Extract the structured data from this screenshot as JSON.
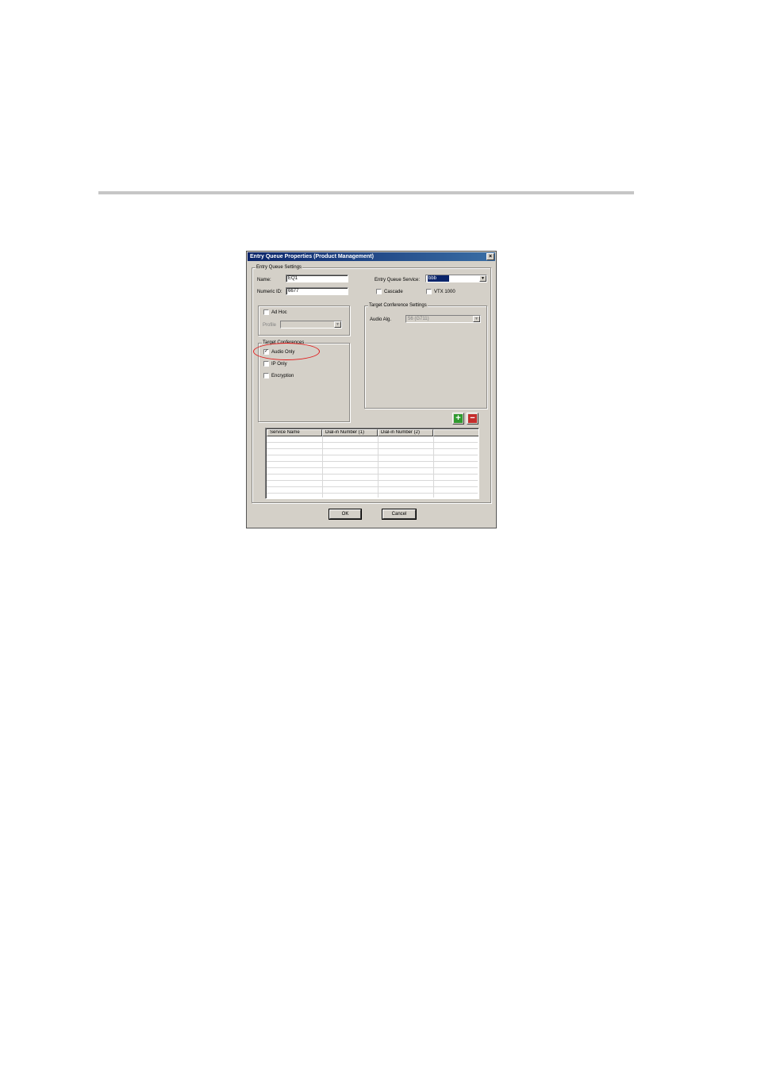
{
  "dialog": {
    "title": "Entry Queue Properties (Product Management)",
    "close_glyph": "×"
  },
  "settings": {
    "group_title": "Entry Queue Settings",
    "name_label": "Name:",
    "name_value": "EQ1",
    "numeric_id_label": "Numeric ID:",
    "numeric_id_value": "6677",
    "service_label": "Entry Queue Service:",
    "service_value": "bbb",
    "cascade_label": "Cascade",
    "cascade_checked": false,
    "vtx_label": "VTX 1000",
    "vtx_checked": false
  },
  "adhoc": {
    "label": "Ad Hoc",
    "checked": false,
    "profile_label": "Profile",
    "profile_value": ""
  },
  "target_conferences": {
    "group_title": "Target Conferences",
    "audio_only_label": "Audio Only",
    "audio_only_checked": true,
    "ip_only_label": "IP Only",
    "ip_only_checked": false,
    "encryption_label": "Encryption",
    "encryption_checked": false
  },
  "target_conference_settings": {
    "group_title": "Target Conference Settings",
    "audio_alg_label": "Audio Alg.",
    "audio_alg_value": "56 (G711)"
  },
  "table": {
    "columns": [
      "Service Name",
      "Dial-in Number (1)",
      "Dial-in Number (2)",
      ""
    ],
    "rows": []
  },
  "buttons": {
    "ok": "OK",
    "cancel": "Cancel",
    "add_glyph": "+",
    "remove_glyph": "−"
  },
  "colors": {
    "titlebar": "#0a246a",
    "highlight_circle": "#e01a1a",
    "dialog_face": "#d4d0c8"
  }
}
